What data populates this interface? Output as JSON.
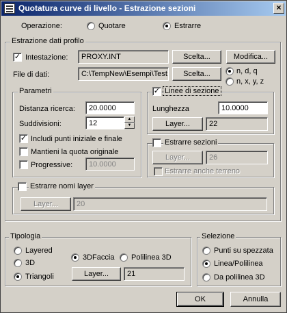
{
  "window": {
    "title": "Quotatura curve di livello - Estrazione sezioni",
    "close_glyph": "×"
  },
  "operation": {
    "label": "Operazione:",
    "option_quote": "Quotare",
    "option_extract": "Estrarre",
    "selected": "Estrarre"
  },
  "profile": {
    "group_label": "Estrazione dati profilo",
    "header_label": "Intestazione:",
    "header_checked": true,
    "header_value": "PROXY.INT",
    "select_button": "Scelta...",
    "modify_button": "Modifica...",
    "data_file_label": "File di dati:",
    "data_file_value": "C:\\TempNew\\Esempi\\Test.",
    "select_button2": "Scelta...",
    "format_ndq": "n, d, q",
    "format_nxyz": "n, x, y, z",
    "format_selected": "n, d, q"
  },
  "params": {
    "group_label": "Parametri",
    "search_distance_label": "Distanza ricerca:",
    "search_distance_value": "20.0000",
    "subdivisions_label": "Suddivisioni:",
    "subdivisions_value": "12",
    "include_points_label": "Includi punti iniziale e finale",
    "include_points_checked": true,
    "keep_height_label": "Mantieni la quota originale",
    "keep_height_checked": false,
    "progressive_label": "Progressive:",
    "progressive_checked": false,
    "progressive_value": "10.0000"
  },
  "section_lines": {
    "group_label": "Linee di sezione",
    "checked": true,
    "length_label": "Lunghezza",
    "length_value": "10.0000",
    "layer_button": "Layer...",
    "layer_value": "22"
  },
  "extract_sections": {
    "group_label": "Estrarre sezioni",
    "checked": false,
    "layer_button": "Layer...",
    "layer_value": "26",
    "terrain_label": "Estrarre anche terreno",
    "terrain_checked": false
  },
  "layer_names": {
    "group_label": "Estrarre nomi layer",
    "checked": false,
    "layer_button": "Layer...",
    "layer_value": "20"
  },
  "typology": {
    "group_label": "Tipologia",
    "layered": "Layered",
    "threed": "3D",
    "triangles": "Triangoli",
    "face3d": "3DFaccia",
    "polyline3d": "Polilinea 3D",
    "selected_left": "Triangoli",
    "selected_right": "3DFaccia",
    "layer_button": "Layer...",
    "layer_value": "21"
  },
  "selection": {
    "group_label": "Selezione",
    "points_on_polyline": "Punti su spezzata",
    "line_polyline": "Linea/Polilinea",
    "from_polyline3d": "Da polilinea 3D",
    "selected": "Linea/Polilinea"
  },
  "footer": {
    "ok": "OK",
    "cancel": "Annulla"
  }
}
